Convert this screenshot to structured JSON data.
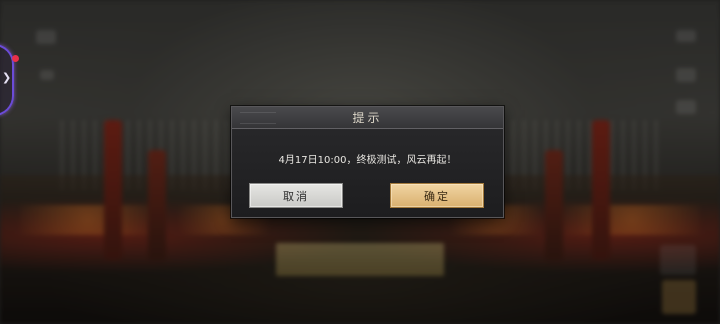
{
  "dialog": {
    "title": "提示",
    "message": "4月17日10:00，终极测试，风云再起！",
    "cancel_label": "取消",
    "confirm_label": "确定"
  },
  "colors": {
    "confirm_button": "#d9b06f",
    "cancel_button": "#d6d6d3",
    "dialog_bg": "#1f1f21",
    "notification_dot": "#e8304a",
    "side_handle": "#6b4bd8"
  },
  "icons": {
    "side_handle": "chevron-right-icon"
  }
}
